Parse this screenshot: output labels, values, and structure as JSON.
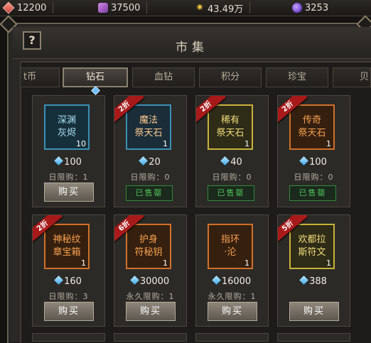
{
  "resources": [
    {
      "icon": "red-gem-icon",
      "value": "12200"
    },
    {
      "icon": "purple-scroll-icon",
      "value": "37500"
    },
    {
      "icon": "gold-sun-icon",
      "value": "43.49万"
    },
    {
      "icon": "purple-orb-icon",
      "value": "3253"
    }
  ],
  "header": {
    "help": "?",
    "title": "市集"
  },
  "tabs": [
    "t币",
    "钻石",
    "血钻",
    "积分",
    "珍宝",
    "贝"
  ],
  "active_tab": "钻石",
  "items": [
    {
      "name": "深渊\n灰烬",
      "count": "10",
      "quality": "blue",
      "discount": "",
      "price": "100",
      "limit": "日限购：1",
      "action": "购买"
    },
    {
      "name": "魔法\n祭天石",
      "count": "1",
      "quality": "blue2",
      "discount": "2折",
      "price": "20",
      "limit": "日限购：0",
      "action": "已售罄"
    },
    {
      "name": "稀有\n祭天石",
      "count": "1",
      "quality": "yellow",
      "discount": "2折",
      "price": "40",
      "limit": "日限购：0",
      "action": "已售罄"
    },
    {
      "name": "传奇\n祭天石",
      "count": "1",
      "quality": "orange",
      "discount": "2折",
      "price": "100",
      "limit": "日限购：0",
      "action": "已售罄"
    },
    {
      "name": "神秘纹\n章宝箱",
      "count": "1",
      "quality": "orange",
      "discount": "2折",
      "price": "160",
      "limit": "日限购：3",
      "action": "购买"
    },
    {
      "name": "护身\n符秘钥",
      "count": "1",
      "quality": "orange",
      "discount": "6折",
      "price": "30000",
      "limit": "永久限购：1",
      "action": "购买"
    },
    {
      "name": "指环\n·沦",
      "count": "1",
      "quality": "orange",
      "discount": "",
      "price": "16000",
      "limit": "永久限购：1",
      "action": "购买"
    },
    {
      "name": "欢都拉\n斯符文",
      "count": "1",
      "quality": "yellow",
      "discount": "5折",
      "price": "388",
      "limit": "",
      "action": "购买"
    }
  ]
}
